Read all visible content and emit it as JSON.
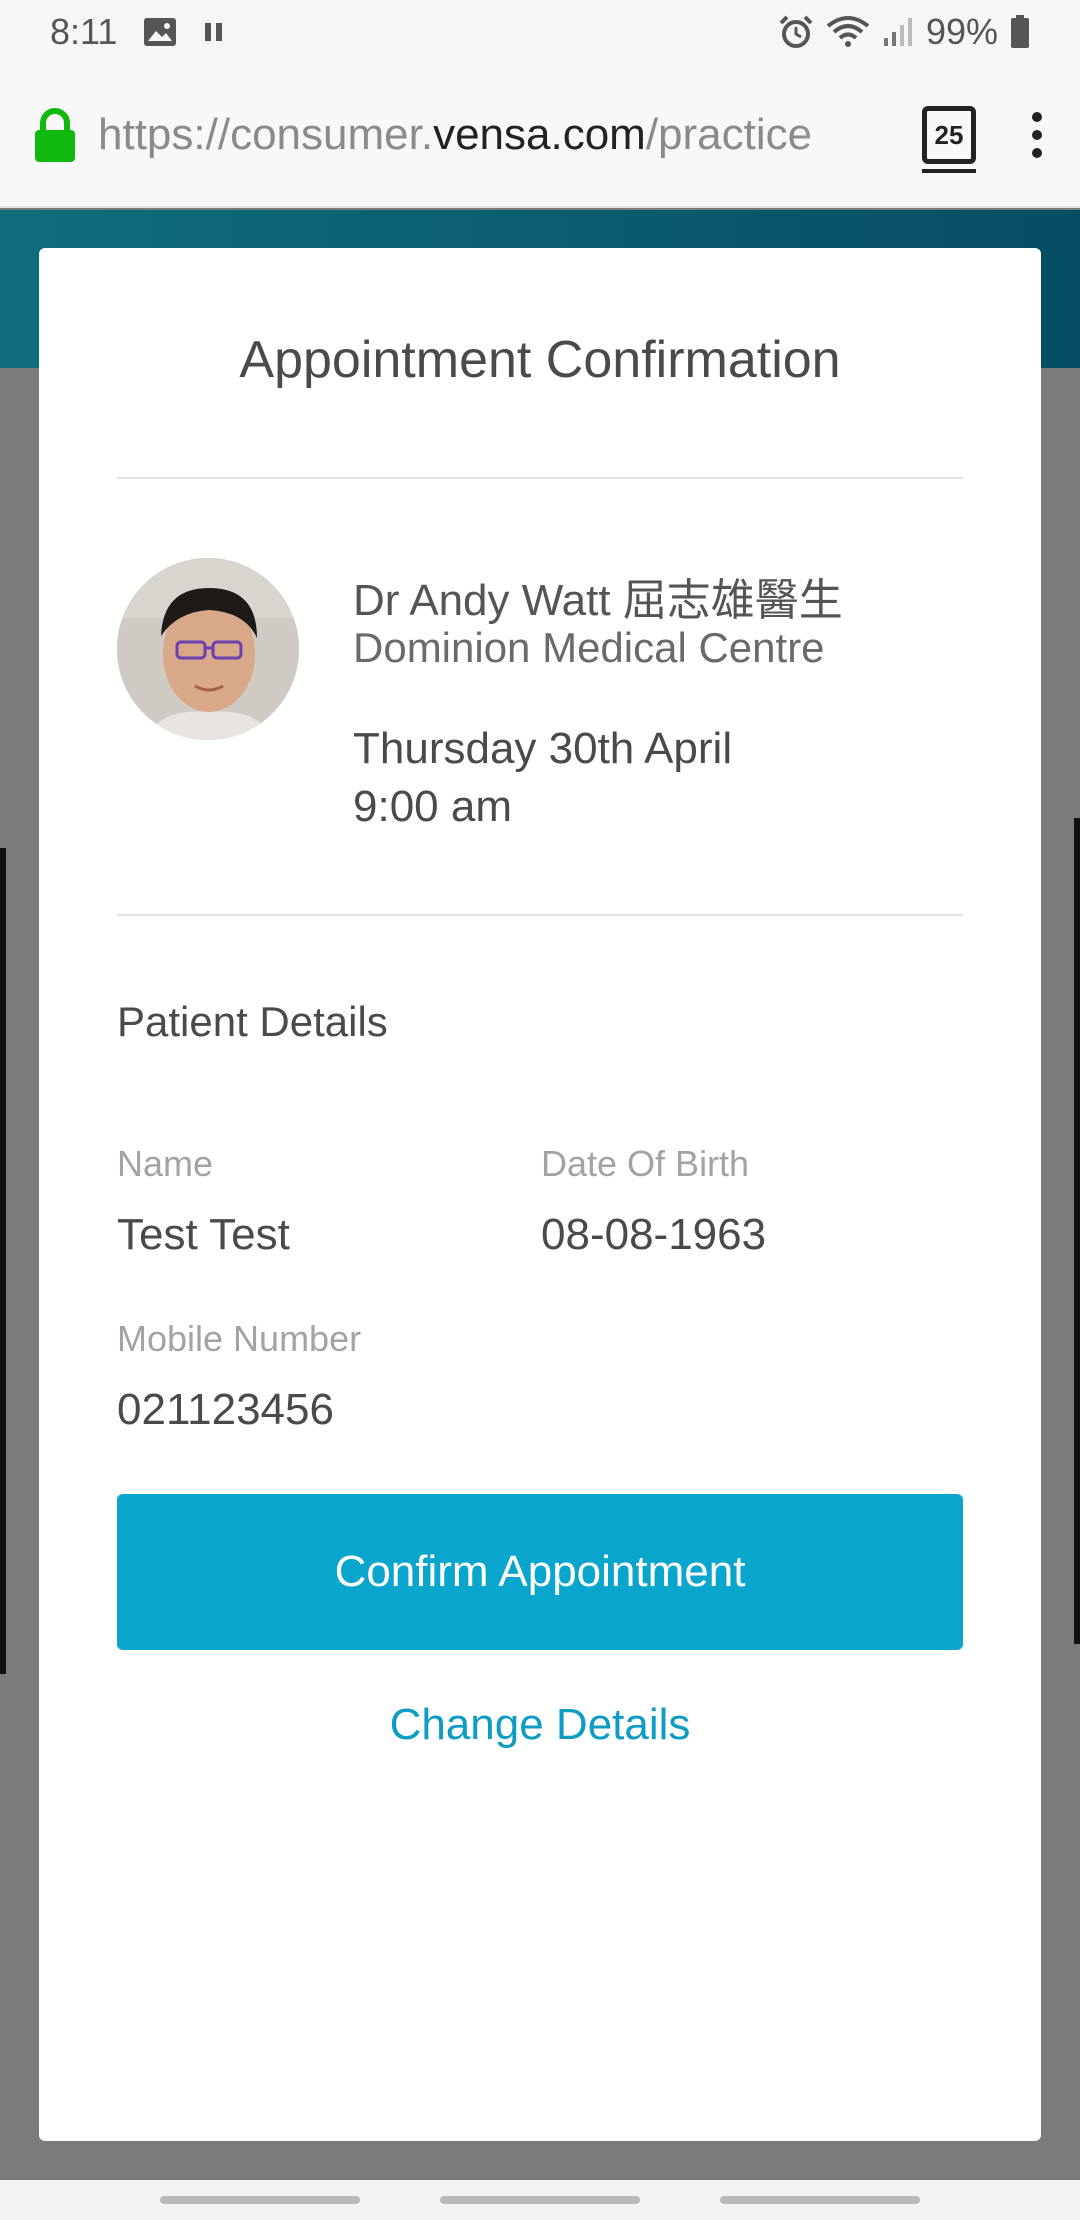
{
  "status_bar": {
    "time": "8:11",
    "battery": "99%",
    "icons": [
      "image-icon",
      "pause-icon",
      "alarm-icon",
      "wifi-icon",
      "signal-icon",
      "battery-icon"
    ]
  },
  "browser": {
    "url_prefix": "https://consumer.",
    "url_domain": "vensa.com",
    "url_suffix": "/practice",
    "tabs_count": "25"
  },
  "modal": {
    "title": "Appointment Confirmation",
    "doctor": {
      "name": "Dr Andy Watt 屈志雄醫生",
      "practice": "Dominion Medical Centre"
    },
    "appointment": {
      "date": "Thursday 30th April",
      "time": "9:00 am"
    },
    "patient": {
      "section_title": "Patient Details",
      "name_label": "Name",
      "name_value": "Test Test",
      "dob_label": "Date Of Birth",
      "dob_value": "08-08-1963",
      "mobile_label": "Mobile Number",
      "mobile_value": "021123456"
    },
    "confirm_label": "Confirm Appointment",
    "change_label": "Change Details"
  },
  "colors": {
    "accent": "#0aa5cc",
    "link": "#0e9cc4",
    "header_teal": "#0a5a6d",
    "overlay": "#7b7b7b"
  }
}
